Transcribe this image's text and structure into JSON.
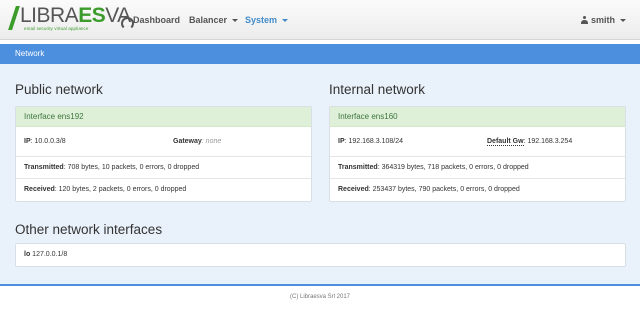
{
  "brand": {
    "name_left": "LIBRA",
    "name_es": "ES",
    "name_right": "VA",
    "tagline": "email security virtual appliance"
  },
  "nav": {
    "dashboard": "Dashboard",
    "balancer": "Balancer",
    "system": "System",
    "user": "smith"
  },
  "page": {
    "title": "Network"
  },
  "public": {
    "heading": "Public network",
    "interface": "Interface ens192",
    "ip_label": "IP",
    "ip_value": ": 10.0.0.3/8",
    "gw_label": "Gateway",
    "gw_value": ": none",
    "tx_label": "Transmitted",
    "tx_value": ": 708 bytes, 10 packets, 0 errors, 0 dropped",
    "rx_label": "Received",
    "rx_value": ": 120 bytes, 2 packets, 0 errors, 0 dropped"
  },
  "internal": {
    "heading": "Internal network",
    "interface": "Interface ens160",
    "ip_label": "IP",
    "ip_value": ": 192.168.3.108/24",
    "gw_label": "Default Gw",
    "gw_value": ": 192.168.3.254",
    "tx_label": "Transmitted",
    "tx_value": ": 364319 bytes, 718 packets, 0 errors, 0 dropped",
    "rx_label": "Received",
    "rx_value": ": 253437 bytes, 790 packets, 0 errors, 0 dropped"
  },
  "other": {
    "heading": "Other network interfaces",
    "lo_label": "lo",
    "lo_value": " 127.0.0.1/8"
  },
  "footer": {
    "text": "(C) Libraesva Srl 2017"
  }
}
